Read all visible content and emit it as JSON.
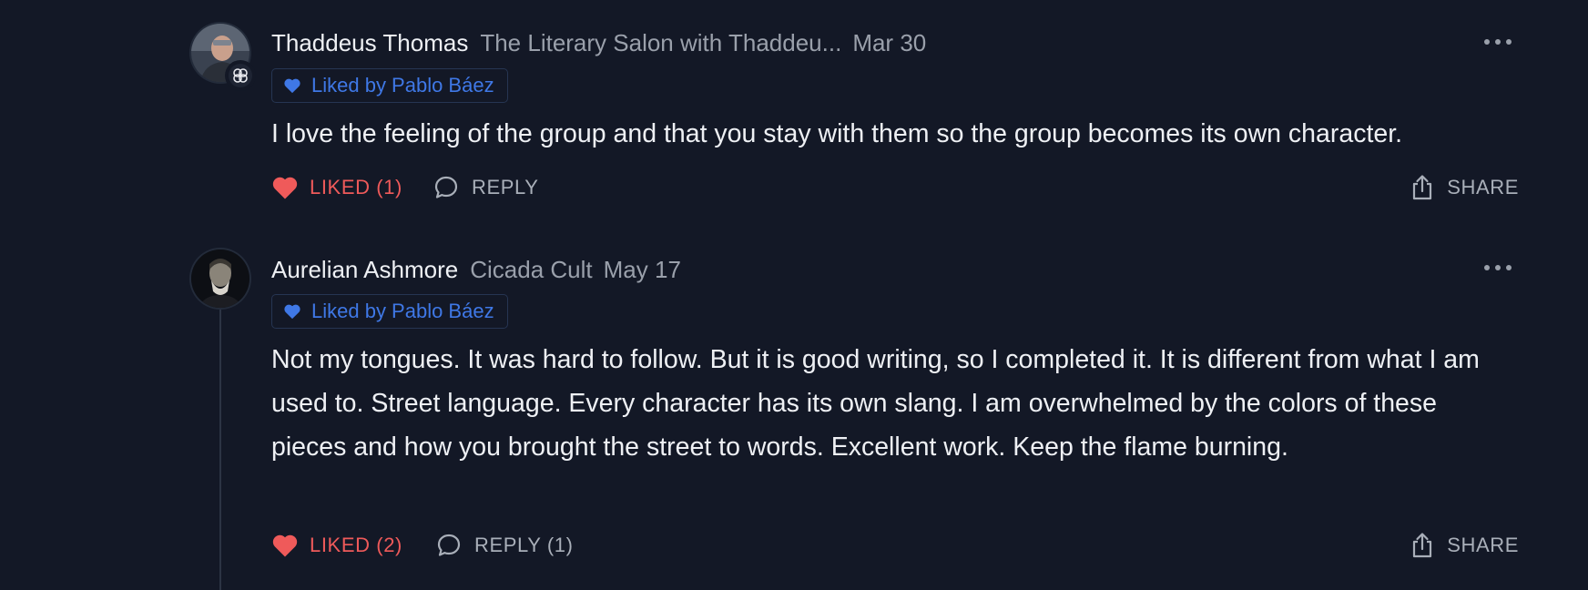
{
  "colors": {
    "background": "#131826",
    "liked": "#ef5a5a",
    "liked_by_text": "#3f78e6",
    "muted": "#9aa0ab"
  },
  "comments": [
    {
      "author": "Thaddeus Thomas",
      "publication": "The Literary Salon with Thaddeu...",
      "date": "Mar 30",
      "liked_by": "Liked by Pablo Báez",
      "body": "I love the feeling of the group and that you stay with them so the group becomes its own character.",
      "like_label": "LIKED (1)",
      "reply_label": "REPLY",
      "share_label": "SHARE",
      "avatar_icon": "avatar-photo",
      "badge_icon": "bestseller-badge-icon"
    },
    {
      "author": "Aurelian Ashmore",
      "publication": "Cicada Cult",
      "date": "May 17",
      "liked_by": "Liked by Pablo Báez",
      "body": "Not my tongues. It was hard to follow. But it is good writing, so I completed it. It is different from what I am used to. Street language. Every character has its own slang. I am overwhelmed by the colors of these pieces and how you brought the street to words. Excellent work. Keep the flame burning.",
      "like_label": "LIKED (2)",
      "reply_label": "REPLY (1)",
      "share_label": "SHARE",
      "avatar_icon": "avatar-photo"
    }
  ]
}
